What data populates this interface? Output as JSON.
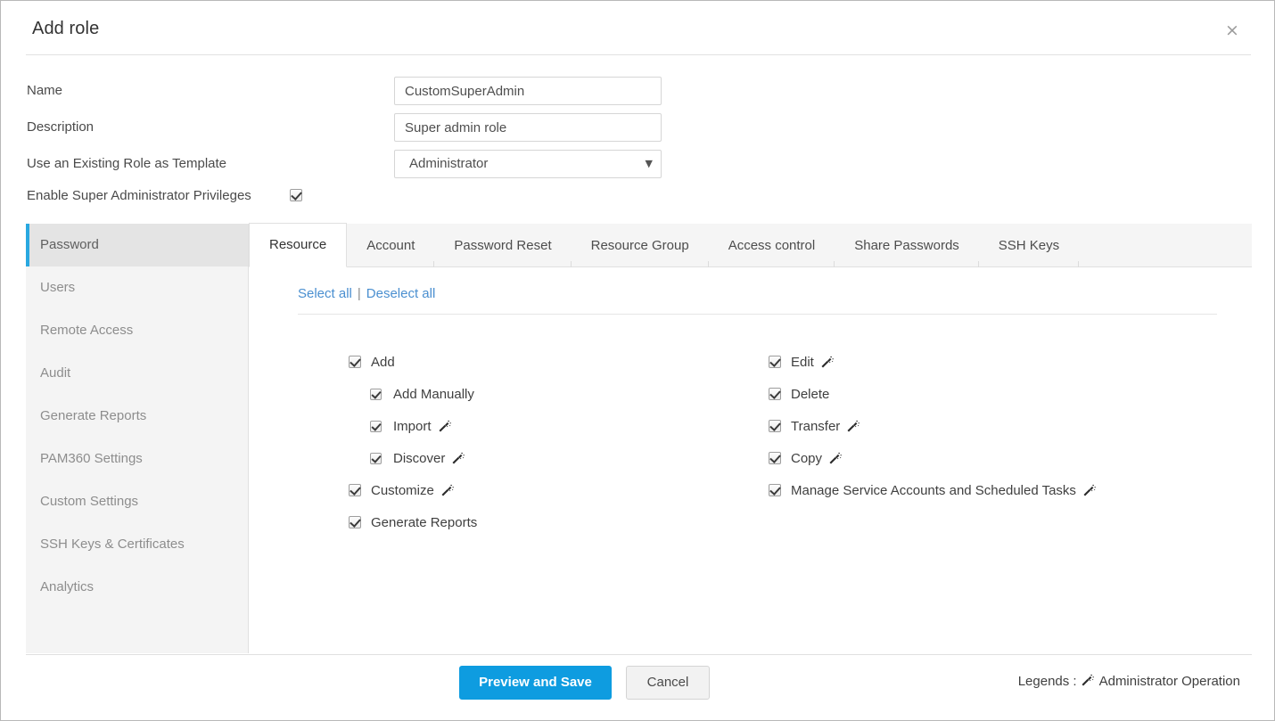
{
  "dialog": {
    "title": "Add role",
    "close_label": "×"
  },
  "form": {
    "fields": [
      {
        "label": "Name",
        "value": "CustomSuperAdmin",
        "type": "text"
      },
      {
        "label": "Description",
        "value": "Super admin role",
        "type": "text"
      },
      {
        "label": "Use an Existing Role as Template",
        "value": "Administrator",
        "type": "select"
      }
    ],
    "super_admin": {
      "label": "Enable Super Administrator Privileges",
      "checked": true
    },
    "template_options": [
      "Administrator"
    ]
  },
  "sidebar": {
    "items": [
      {
        "label": "Password",
        "active": true
      },
      {
        "label": "Users",
        "active": false
      },
      {
        "label": "Remote Access",
        "active": false
      },
      {
        "label": "Audit",
        "active": false
      },
      {
        "label": "Generate Reports",
        "active": false
      },
      {
        "label": "PAM360 Settings",
        "active": false
      },
      {
        "label": "Custom Settings",
        "active": false
      },
      {
        "label": "SSH Keys & Certificates",
        "active": false
      },
      {
        "label": "Analytics",
        "active": false
      }
    ]
  },
  "tabs": [
    {
      "label": "Resource",
      "active": true
    },
    {
      "label": "Account",
      "active": false
    },
    {
      "label": "Password Reset",
      "active": false
    },
    {
      "label": "Resource Group",
      "active": false
    },
    {
      "label": "Access control",
      "active": false
    },
    {
      "label": "Share Passwords",
      "active": false
    },
    {
      "label": "SSH Keys",
      "active": false
    }
  ],
  "selectors": {
    "select_all": "Select all",
    "separator": "|",
    "deselect_all": "Deselect all"
  },
  "permissions": {
    "left": [
      {
        "label": "Add",
        "checked": true,
        "indent": false,
        "admin_op": false
      },
      {
        "label": "Add Manually",
        "checked": true,
        "indent": true,
        "admin_op": false
      },
      {
        "label": "Import",
        "checked": true,
        "indent": true,
        "admin_op": true
      },
      {
        "label": "Discover",
        "checked": true,
        "indent": true,
        "admin_op": true
      },
      {
        "label": "Customize",
        "checked": true,
        "indent": false,
        "admin_op": true
      },
      {
        "label": "Generate Reports",
        "checked": true,
        "indent": false,
        "admin_op": false
      }
    ],
    "right": [
      {
        "label": "Edit",
        "checked": true,
        "indent": false,
        "admin_op": true
      },
      {
        "label": "Delete",
        "checked": true,
        "indent": false,
        "admin_op": false
      },
      {
        "label": "Transfer",
        "checked": true,
        "indent": false,
        "admin_op": true
      },
      {
        "label": "Copy",
        "checked": true,
        "indent": false,
        "admin_op": true
      },
      {
        "label": "Manage Service Accounts and Scheduled Tasks",
        "checked": true,
        "indent": false,
        "admin_op": true
      }
    ]
  },
  "footer": {
    "primary_button": "Preview and Save",
    "secondary_button": "Cancel",
    "legend_prefix": "Legends :",
    "legend_text": "Administrator Operation"
  },
  "colors": {
    "accent_blue": "#0e9ce0",
    "link_blue": "#4a8fd0",
    "active_tab_bg": "#ffffff",
    "sidebar_bg": "#f4f4f4",
    "sidebar_active_bg": "#e4e4e4"
  }
}
